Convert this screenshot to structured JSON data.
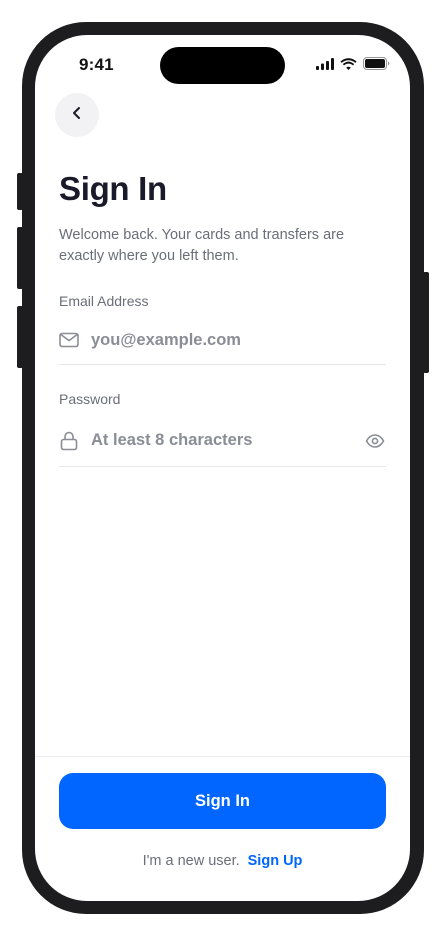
{
  "status_bar": {
    "time": "9:41",
    "icons": [
      "signal-icon",
      "wifi-icon",
      "battery-icon"
    ]
  },
  "header": {
    "back_icon": "chevron-left-icon"
  },
  "content": {
    "title": "Sign In",
    "subtitle": "Welcome back. Your cards and transfers are exactly where you left them."
  },
  "form": {
    "email": {
      "label": "Email Address",
      "value": "",
      "placeholder": "you@example.com",
      "icon": "mail-icon"
    },
    "password": {
      "label": "Password",
      "value": "",
      "placeholder": "At least 8 characters",
      "icon": "lock-icon",
      "toggle_icon": "eye-icon"
    }
  },
  "actions": {
    "sign_in_label": "Sign In",
    "new_user_text": "I'm a new user.",
    "sign_up_label": "Sign Up"
  },
  "colors": {
    "accent": "#0066ff",
    "title": "#1a1a2a",
    "muted": "#6b6e78",
    "frame": "#1d1d1f"
  }
}
